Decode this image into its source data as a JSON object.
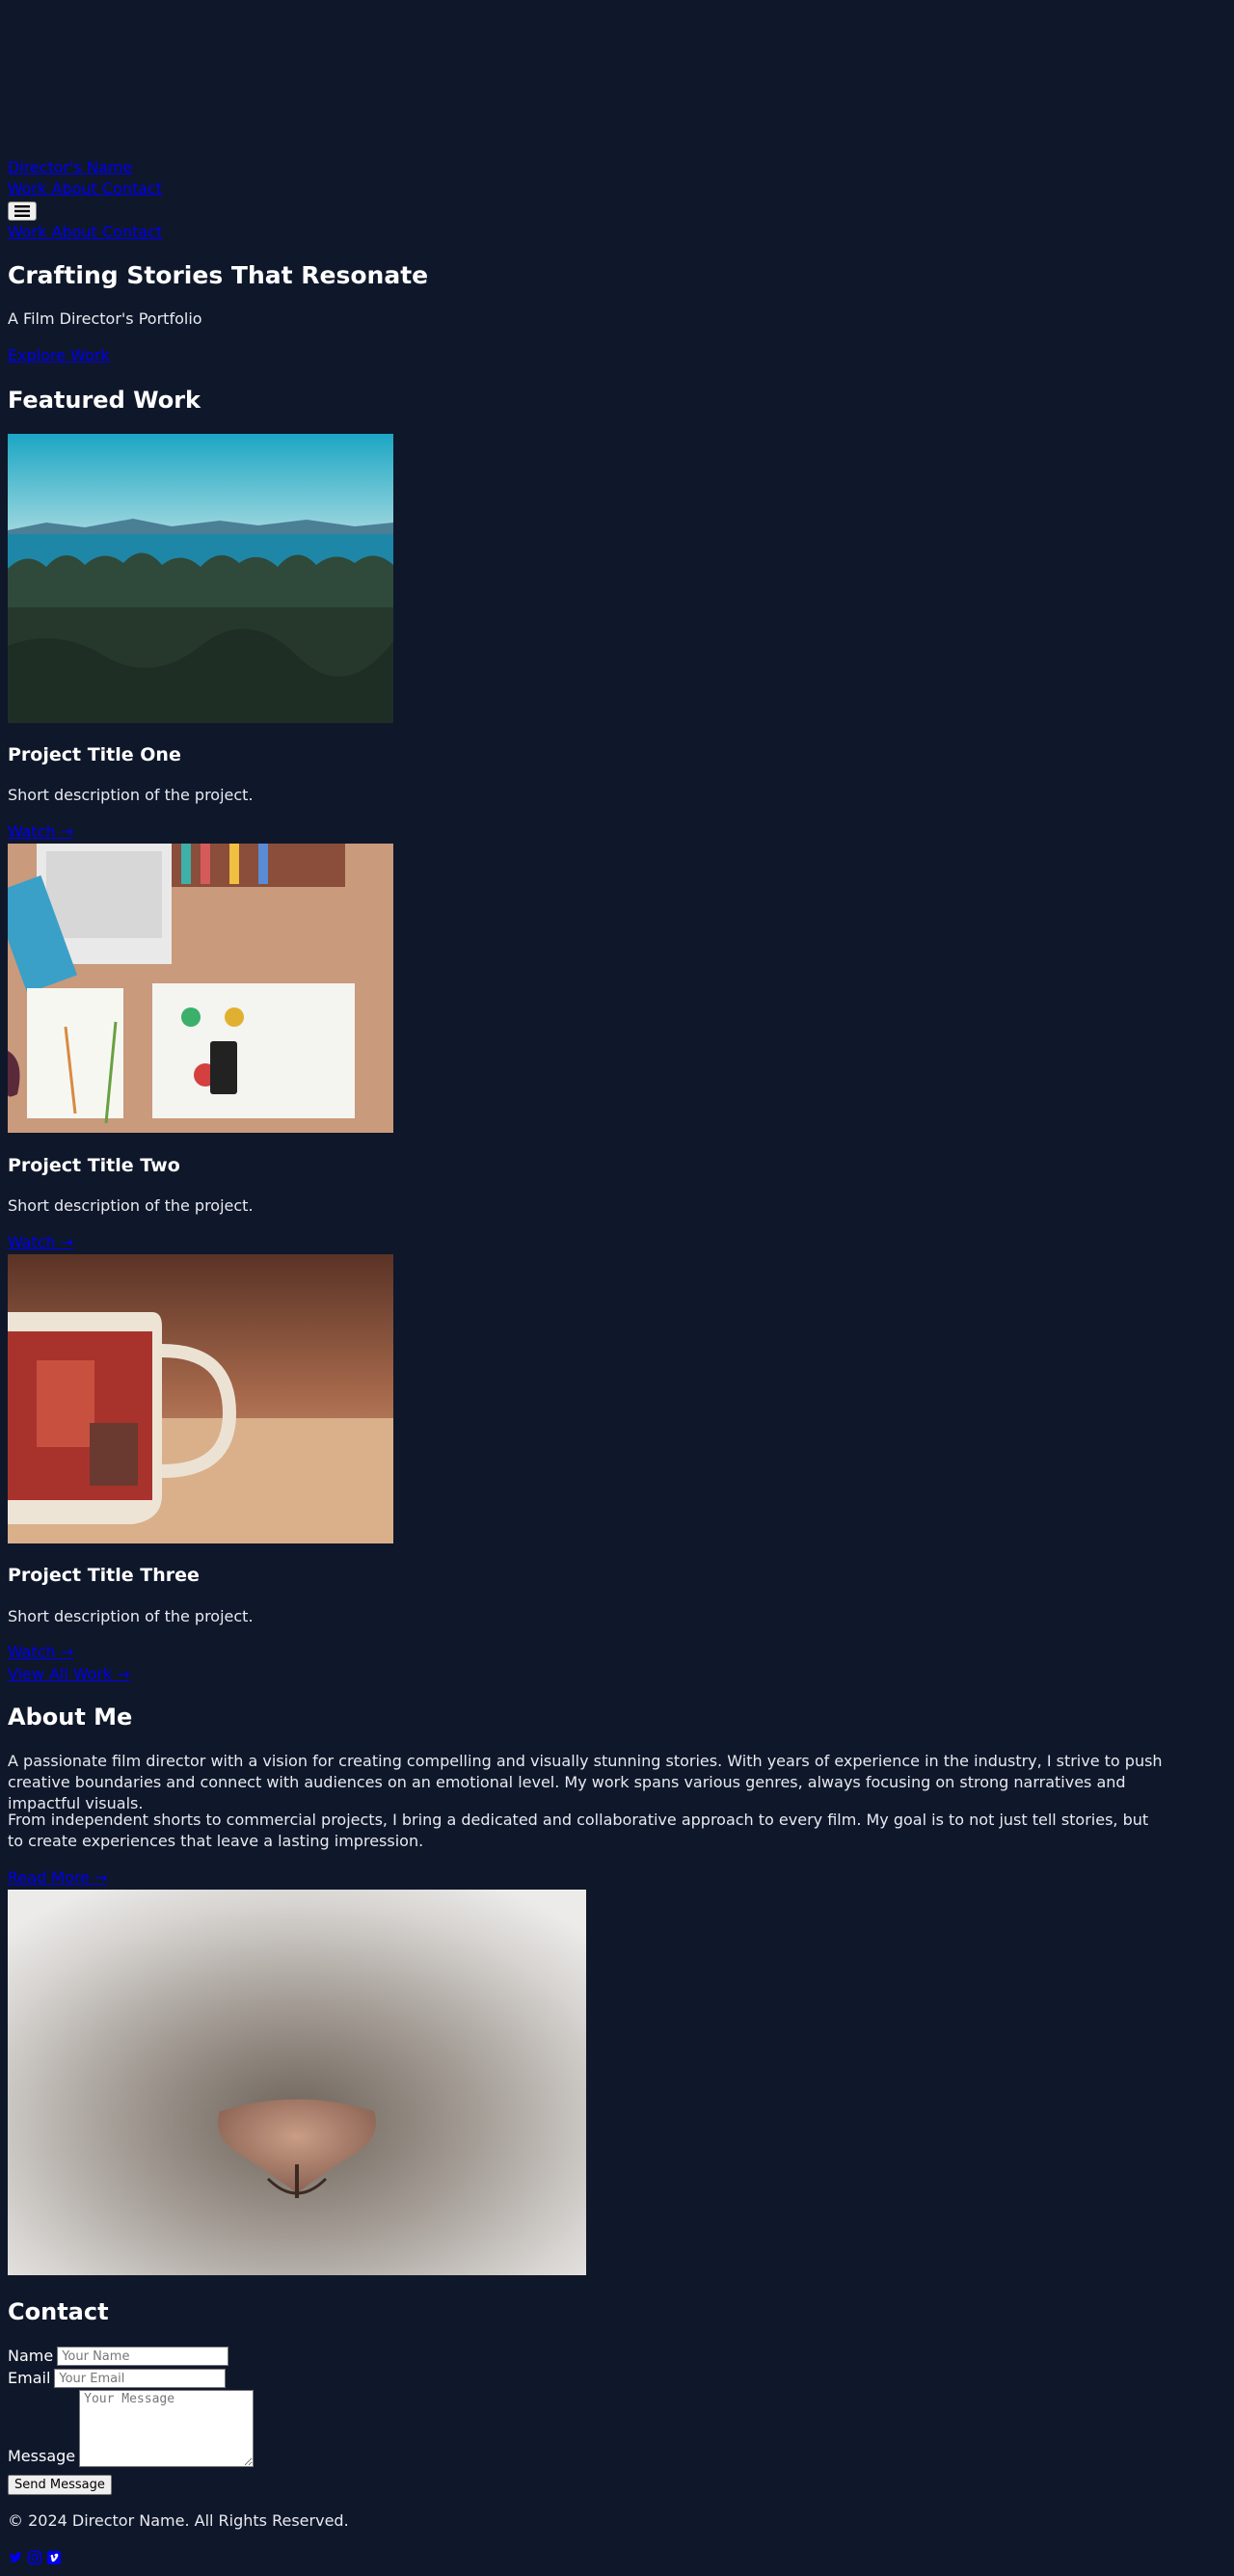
{
  "nav": {
    "brand_links": "Director's Name",
    "links_top": "Work About Contact",
    "links_mobile": "Work About Contact"
  },
  "hero": {
    "title": "Crafting Stories That Resonate",
    "subtitle": "A Film Director's Portfolio",
    "cta": "Explore Work"
  },
  "featured": {
    "heading": "Featured Work",
    "projects": [
      {
        "title": "Project Title One",
        "description": "Short description of the project.",
        "link": "Watch →"
      },
      {
        "title": "Project Title Two",
        "description": "Short description of the project.",
        "link": "Watch →"
      },
      {
        "title": "Project Title Three",
        "description": "Short description of the project.",
        "link": "Watch →"
      }
    ],
    "view_all": "View All Work →"
  },
  "about": {
    "heading": "About Me",
    "paragraph1": "A passionate film director with a vision for creating compelling and visually stunning stories. With years of experience in the industry, I strive to push creative boundaries and connect with audiences on an emotional level. My work spans various genres, always focusing on strong narratives and impactful visuals.",
    "paragraph2": "From independent shorts to commercial projects, I bring a dedicated and collaborative approach to every film. My goal is to not just tell stories, but to create experiences that leave a lasting impression.",
    "read_more": "Read More →"
  },
  "contact": {
    "heading": "Contact",
    "name_label": "Name",
    "name_placeholder": "Your Name",
    "email_label": "Email",
    "email_placeholder": "Your Email",
    "message_label": "Message",
    "message_placeholder": "Your Message",
    "submit": "Send Message"
  },
  "footer": {
    "copyright": "© 2024 Director Name. All Rights Reserved.",
    "social_icons": [
      "twitter-icon",
      "instagram-icon",
      "vimeo-icon"
    ]
  },
  "colors": {
    "background": "#0f172a",
    "link": "#0000ee",
    "text": "#ffffff"
  }
}
